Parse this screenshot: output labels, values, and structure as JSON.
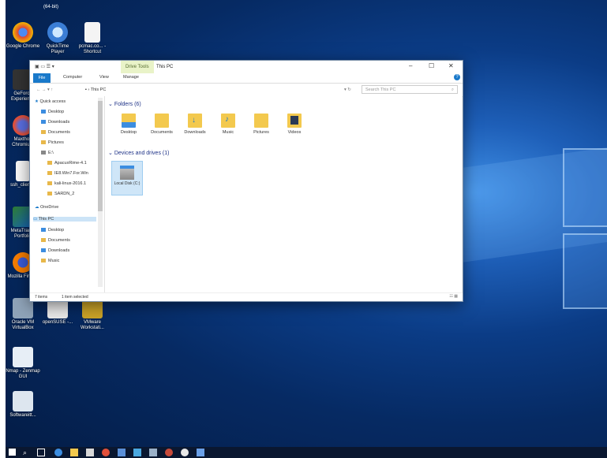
{
  "desktop": {
    "top_label": "(64-bit)",
    "icons": [
      {
        "label": "Google Chrome",
        "icon": "chrome-icon"
      },
      {
        "label": "QuickTime Player",
        "icon": "quicktime-icon"
      },
      {
        "label": "pcmac.co... - Shortcut",
        "icon": "shortcut-file-icon"
      },
      {
        "label": "GeForce Experience",
        "icon": "geforce-icon"
      },
      {
        "label": "Maxthon Chromium",
        "icon": "maxthon-icon"
      },
      {
        "label": "ssh_client...",
        "icon": "file-icon"
      },
      {
        "label": "MetaTrader Portfolio",
        "icon": "metatrader-icon"
      },
      {
        "label": "Mozilla Firefox",
        "icon": "firefox-icon"
      },
      {
        "label": "Oracle VM VirtualBox",
        "icon": "virtualbox-icon"
      },
      {
        "label": "openSUSE -...",
        "icon": "opensuse-icon"
      },
      {
        "label": "VMware Workstati...",
        "icon": "vmware-icon"
      },
      {
        "label": "Nmap - Zenmap GUI",
        "icon": "zenmap-icon"
      },
      {
        "label": "Softwareitt...",
        "icon": "software-icon"
      }
    ]
  },
  "explorer": {
    "title": "This PC",
    "drive_tools": "Drive Tools",
    "ribbon_tabs": [
      "File",
      "Computer",
      "View",
      "Manage"
    ],
    "address_path": "This PC",
    "search_placeholder": "Search This PC",
    "nav_pane": [
      {
        "label": "Quick access"
      },
      {
        "label": "Desktop"
      },
      {
        "label": "Downloads"
      },
      {
        "label": "Documents"
      },
      {
        "label": "Pictures"
      },
      {
        "label": "E:\\"
      },
      {
        "label": "ApacuxRime-4.1"
      },
      {
        "label": "IE8.Win7.For.Win"
      },
      {
        "label": "kali-linux-2016.1"
      },
      {
        "label": "SARDN_2"
      },
      {
        "label": "OneDrive"
      },
      {
        "label": "This PC"
      },
      {
        "label": "Desktop"
      },
      {
        "label": "Documents"
      },
      {
        "label": "Downloads"
      },
      {
        "label": "Music"
      }
    ],
    "folders_header": "Folders (6)",
    "folders": [
      "Desktop",
      "Documents",
      "Downloads",
      "Music",
      "Pictures",
      "Videos"
    ],
    "devices_header": "Devices and drives (1)",
    "drive_label": "Local Disk (C:)",
    "status_items": "7 items",
    "status_selected": "1 item selected"
  },
  "colors": {
    "accent": "#1979ca",
    "selection": "#cce4f7",
    "folder": "#f3c94e"
  }
}
